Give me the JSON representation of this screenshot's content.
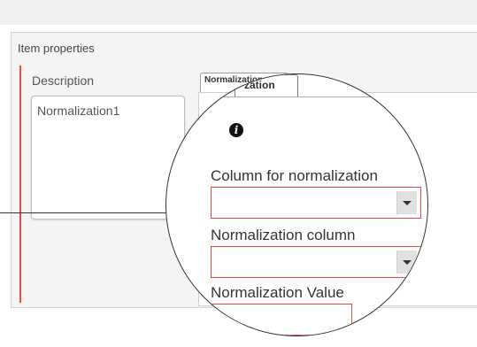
{
  "item_properties": {
    "title": "Item properties",
    "description_label": "Description",
    "description_value": "Normalization1"
  },
  "normalization_tab": {
    "label": "Normalization",
    "magnified_label": "zation"
  },
  "fields": {
    "column_for_normalization_label": "Column for normalization",
    "normalization_column_label": "Normalization column",
    "normalization_value_label": "Normalization Value"
  },
  "colors": {
    "required_red": "#e44b4b",
    "panel_bg": "#f4f4f4"
  },
  "icons": {
    "info": "info-icon",
    "dropdown": "chevron-down-icon"
  }
}
